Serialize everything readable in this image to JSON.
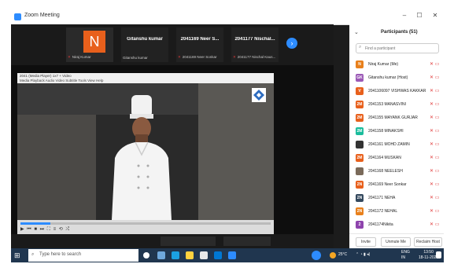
{
  "window": {
    "title": "Zoom Meeting",
    "minimize": "–",
    "maximize": "☐",
    "close": "✕"
  },
  "gallery": {
    "tiles": [
      {
        "avatar_letter": "N",
        "name": "",
        "sub": "Niraj Kumar"
      },
      {
        "name": "Gitanshu kumar",
        "sub": "Gitanshu kumar"
      },
      {
        "name": "2041169 Neer S...",
        "sub": "2041169 Neer Sonkar"
      },
      {
        "name": "2041177 Nischal...",
        "sub": "2041177 Nischal Kaus..."
      }
    ],
    "next_icon": "chevron-right-icon"
  },
  "share": {
    "window_title": "2041 (Media Player) 1x7 + Video",
    "menu": "Media  Playback  Audio  Video  Subtitle  Tools  View  Help",
    "progress": 0.12,
    "controls": "▶ ⏮ ■ ⏭ ⛶ ≡ ⟲ ⤮"
  },
  "panel": {
    "title": "Participants (51)",
    "search_placeholder": "Find a participant",
    "participants": [
      {
        "initials": "N",
        "color": "#e8801c",
        "name": "Niraj Kumar (Me)"
      },
      {
        "initials": "GK",
        "color": "#9b59b6",
        "name": "Gitanshu kumar (Host)"
      },
      {
        "initials": "V",
        "color": "#e8601c",
        "name": "2041106097 VISHWAS KAKKAR"
      },
      {
        "initials": "2M",
        "color": "#e8601c",
        "name": "2041153 MANASVINI"
      },
      {
        "initials": "2M",
        "color": "#e8601c",
        "name": "2041155 MAYANK GURJAR"
      },
      {
        "initials": "2M",
        "color": "#1abc9c",
        "name": "2041158 MINAKSHI"
      },
      {
        "initials": "",
        "color": "#333333",
        "name": "2041161 MOHD ZAMIN"
      },
      {
        "initials": "2M",
        "color": "#e8601c",
        "name": "2041164 MUSKAN"
      },
      {
        "initials": "",
        "color": "#7a6a5a",
        "name": "2041168 NEELESH"
      },
      {
        "initials": "2N",
        "color": "#e8601c",
        "name": "2041169 Neer Sonkar"
      },
      {
        "initials": "2N",
        "color": "#34495e",
        "name": "2041171 NEHA"
      },
      {
        "initials": "2N",
        "color": "#e8801c",
        "name": "2041172 NEHAL"
      },
      {
        "initials": "2",
        "color": "#8e44ad",
        "name": "2041174Nikita"
      }
    ],
    "buttons": {
      "invite": "Invite",
      "unmute": "Unmute Me",
      "reclaim": "Reclaim Host"
    }
  },
  "taskbar": {
    "search_placeholder": "Type here to search",
    "weather": "25°C",
    "lang": "ENG\nIN",
    "time": "13:50",
    "date": "18-11-2021"
  }
}
